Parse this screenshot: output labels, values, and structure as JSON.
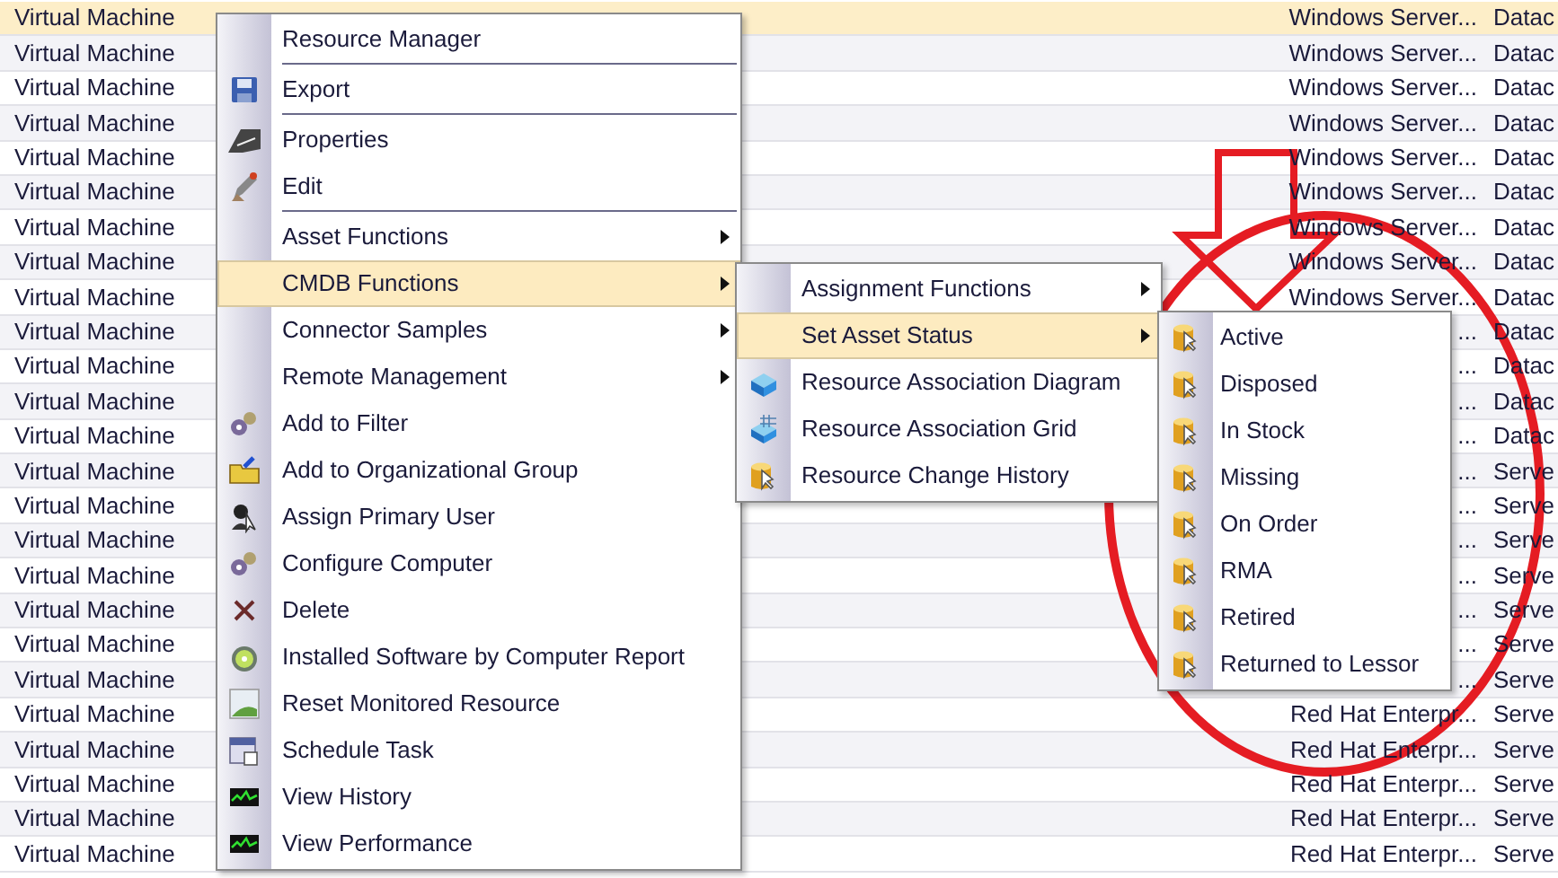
{
  "table": {
    "rows": [
      {
        "column_1": "Virtual Machine",
        "column_3": "Windows Server...",
        "column_4": "Datac",
        "selected": true
      },
      {
        "column_1": "Virtual Machine",
        "column_3": "Windows Server...",
        "column_4": "Datac",
        "selected": false
      },
      {
        "column_1": "Virtual Machine",
        "column_3": "Windows Server...",
        "column_4": "Datac",
        "selected": false
      },
      {
        "column_1": "Virtual Machine",
        "column_3": "Windows Server...",
        "column_4": "Datac",
        "selected": false
      },
      {
        "column_1": "Virtual Machine",
        "column_3": "Windows Server...",
        "column_4": "Datac",
        "selected": false
      },
      {
        "column_1": "Virtual Machine",
        "column_3": "Windows Server...",
        "column_4": "Datac",
        "selected": false
      },
      {
        "column_1": "Virtual Machine",
        "column_3": "Windows Server...",
        "column_4": "Datac",
        "selected": false
      },
      {
        "column_1": "Virtual Machine",
        "column_3": "Windows Server...",
        "column_4": "Datac",
        "selected": false
      },
      {
        "column_1": "Virtual Machine",
        "column_3": "Windows Server...",
        "column_4": "Datac",
        "selected": false
      },
      {
        "column_1": "Virtual Machine",
        "column_3": "...",
        "column_4": "Datac",
        "selected": false
      },
      {
        "column_1": "Virtual Machine",
        "column_3": "...",
        "column_4": "Datac",
        "selected": false
      },
      {
        "column_1": "Virtual Machine",
        "column_3": "...",
        "column_4": "Datac",
        "selected": false
      },
      {
        "column_1": "Virtual Machine",
        "column_3": "...",
        "column_4": "Datac",
        "selected": false
      },
      {
        "column_1": "Virtual Machine",
        "column_3": "...",
        "column_4": "Serve",
        "selected": false
      },
      {
        "column_1": "Virtual Machine",
        "column_3": "...",
        "column_4": "Serve",
        "selected": false
      },
      {
        "column_1": "Virtual Machine",
        "column_3": "...",
        "column_4": "Serve",
        "selected": false
      },
      {
        "column_1": "Virtual Machine",
        "column_3": "...",
        "column_4": "Serve",
        "selected": false
      },
      {
        "column_1": "Virtual Machine",
        "column_3": "...",
        "column_4": "Serve",
        "selected": false
      },
      {
        "column_1": "Virtual Machine",
        "column_3": "...",
        "column_4": "Serve",
        "selected": false
      },
      {
        "column_1": "Virtual Machine",
        "column_3": "...",
        "column_4": "Serve",
        "selected": false
      },
      {
        "column_1": "Virtual Machine",
        "column_3": "Red Hat Enterpr...",
        "column_4": "Serve",
        "selected": false
      },
      {
        "column_1": "Virtual Machine",
        "column_3": "Red Hat Enterpr...",
        "column_4": "Serve",
        "selected": false
      },
      {
        "column_1": "Virtual Machine",
        "column_3": "Red Hat Enterpr...",
        "column_4": "Serve",
        "selected": false
      },
      {
        "column_1": "Virtual Machine",
        "column_3": "Red Hat Enterpr...",
        "column_4": "Serve",
        "selected": false
      },
      {
        "column_1": "Virtual Machine",
        "column_3": "Red Hat Enterpr...",
        "column_4": "Serve",
        "selected": false
      }
    ]
  },
  "context_menu": {
    "items": [
      {
        "label": "Resource Manager",
        "selected": false,
        "submenu": false,
        "separator_after": true
      },
      {
        "label": "Export",
        "selected": false,
        "submenu": false,
        "separator_after": true
      },
      {
        "label": "Properties",
        "selected": false,
        "submenu": false,
        "separator_after": false
      },
      {
        "label": "Edit",
        "selected": false,
        "submenu": false,
        "separator_after": true
      },
      {
        "label": "Asset Functions",
        "selected": false,
        "submenu": true,
        "separator_after": false
      },
      {
        "label": "CMDB Functions",
        "selected": true,
        "submenu": true,
        "separator_after": false
      },
      {
        "label": "Connector Samples",
        "selected": false,
        "submenu": true,
        "separator_after": false
      },
      {
        "label": "Remote Management",
        "selected": false,
        "submenu": true,
        "separator_after": false
      },
      {
        "label": "Add to Filter",
        "selected": false,
        "submenu": false,
        "separator_after": false
      },
      {
        "label": "Add to Organizational Group",
        "selected": false,
        "submenu": false,
        "separator_after": false
      },
      {
        "label": "Assign Primary User",
        "selected": false,
        "submenu": false,
        "separator_after": false
      },
      {
        "label": "Configure Computer",
        "selected": false,
        "submenu": false,
        "separator_after": false
      },
      {
        "label": "Delete",
        "selected": false,
        "submenu": false,
        "separator_after": false
      },
      {
        "label": "Installed Software by Computer Report",
        "selected": false,
        "submenu": false,
        "separator_after": false
      },
      {
        "label": "Reset Monitored Resource",
        "selected": false,
        "submenu": false,
        "separator_after": false
      },
      {
        "label": "Schedule Task",
        "selected": false,
        "submenu": false,
        "separator_after": false
      },
      {
        "label": "View History",
        "selected": false,
        "submenu": false,
        "separator_after": false
      },
      {
        "label": "View Performance",
        "selected": false,
        "submenu": false,
        "separator_after": false
      }
    ]
  },
  "cmdb_submenu": {
    "items": [
      {
        "label": "Assignment Functions",
        "selected": false,
        "submenu": true,
        "separator_after": false
      },
      {
        "label": "Set Asset Status",
        "selected": true,
        "submenu": true,
        "separator_after": false
      },
      {
        "label": "Resource Association Diagram",
        "selected": false,
        "submenu": false,
        "separator_after": false
      },
      {
        "label": "Resource Association Grid",
        "selected": false,
        "submenu": false,
        "separator_after": false
      },
      {
        "label": "Resource Change History",
        "selected": false,
        "submenu": false,
        "separator_after": false
      }
    ]
  },
  "status_submenu": {
    "items": [
      {
        "label": "Active",
        "selected": false,
        "submenu": false,
        "separator_after": false
      },
      {
        "label": "Disposed",
        "selected": false,
        "submenu": false,
        "separator_after": false
      },
      {
        "label": "In Stock",
        "selected": false,
        "submenu": false,
        "separator_after": false
      },
      {
        "label": "Missing",
        "selected": false,
        "submenu": false,
        "separator_after": false
      },
      {
        "label": "On Order",
        "selected": false,
        "submenu": false,
        "separator_after": false
      },
      {
        "label": "RMA",
        "selected": false,
        "submenu": false,
        "separator_after": false
      },
      {
        "label": "Retired",
        "selected": false,
        "submenu": false,
        "separator_after": false
      },
      {
        "label": "Returned to Lessor",
        "selected": false,
        "submenu": false,
        "separator_after": false
      }
    ]
  }
}
